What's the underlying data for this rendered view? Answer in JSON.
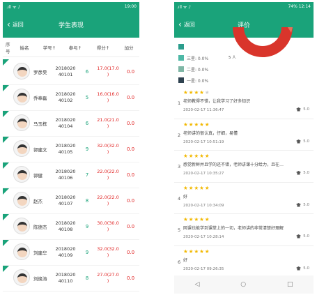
{
  "left": {
    "status": {
      "left": " .ıll ᯤ ♪",
      "right": "19:00"
    },
    "header": {
      "back_label": "返回",
      "title": "学生表现"
    },
    "columns": [
      "序号",
      "姓名",
      "学号↑",
      "参与↑",
      "得分↑",
      "加分"
    ],
    "students": [
      {
        "name": "罗彦昊",
        "id1": "2018020",
        "id2": "40101",
        "join": "6",
        "score1": "17.0(17.0",
        "score2": ")",
        "bonus": "0.0"
      },
      {
        "name": "乔奉磊",
        "id1": "2018020",
        "id2": "40102",
        "join": "5",
        "score1": "16.0(16.0",
        "score2": ")",
        "bonus": "0.0"
      },
      {
        "name": "马玉栋",
        "id1": "2018020",
        "id2": "40104",
        "join": "6",
        "score1": "21.0(21.0",
        "score2": ")",
        "bonus": "0.0"
      },
      {
        "name": "郭建文",
        "id1": "2018020",
        "id2": "40105",
        "join": "9",
        "score1": "32.0(32.0",
        "score2": ")",
        "bonus": "0.0"
      },
      {
        "name": "郭健",
        "id1": "2018020",
        "id2": "40106",
        "join": "7",
        "score1": "22.0(22.0",
        "score2": ")",
        "bonus": "0.0"
      },
      {
        "name": "赵杰",
        "id1": "2018020",
        "id2": "40107",
        "join": "8",
        "score1": "22.0(22.0",
        "score2": ")",
        "bonus": "0.0"
      },
      {
        "name": "陈德杰",
        "id1": "2018020",
        "id2": "40108",
        "join": "9",
        "score1": "30.0(30.0",
        "score2": ")",
        "bonus": "0.0"
      },
      {
        "name": "刘建华",
        "id1": "2018020",
        "id2": "40109",
        "join": "9",
        "score1": "32.0(32.0",
        "score2": ")",
        "bonus": "0.0"
      },
      {
        "name": "刘焕涛",
        "id1": "2018020",
        "id2": "40110",
        "join": "8",
        "score1": "27.0(27.0",
        "score2": ")",
        "bonus": "0.0"
      }
    ]
  },
  "right": {
    "status": {
      "left": ".ıll ᯤ ♪",
      "right": "74% 12:14"
    },
    "header": {
      "back_label": "返回",
      "title": "评价"
    },
    "legend": [
      {
        "label": "",
        "color": "#2b9d8c"
      },
      {
        "label": "三星: 0.0%",
        "color": "#4db8a6"
      },
      {
        "label": "二星: 0.0%",
        "color": "#7fb7a6"
      },
      {
        "label": "一星: 0.0%",
        "color": "#2f4250"
      }
    ],
    "donut_label": "5 人",
    "reviews": [
      {
        "idx": "1",
        "stars": 4,
        "text": "老师教得不错，让我学习了好多知识",
        "date": "2020-02-17 11:36:47",
        "score": "5.0"
      },
      {
        "idx": "2",
        "stars": 5,
        "text": "老师讲的很认真，仔细，易懂",
        "date": "2020-02-17 10:51:19",
        "score": "5.0"
      },
      {
        "idx": "3",
        "stars": 5,
        "text": "感觉新鲜并且学的还不错，老师讲课十分给力，且在…",
        "date": "2020-02-17 10:35:27",
        "score": "5.0"
      },
      {
        "idx": "4",
        "stars": 5,
        "text": "好",
        "date": "2020-02-17 10:34:09",
        "score": "5.0"
      },
      {
        "idx": "5",
        "stars": 5,
        "text": "网课也能学到课堂上的一切，老师讲的非常清楚好理解",
        "date": "2020-02-17 10:28:14",
        "score": "5.0"
      },
      {
        "idx": "6",
        "stars": 5,
        "text": "好",
        "date": "2020-02-17 09:26:35",
        "score": "5.0"
      }
    ],
    "navbar": [
      "◁",
      "○",
      "□"
    ]
  }
}
